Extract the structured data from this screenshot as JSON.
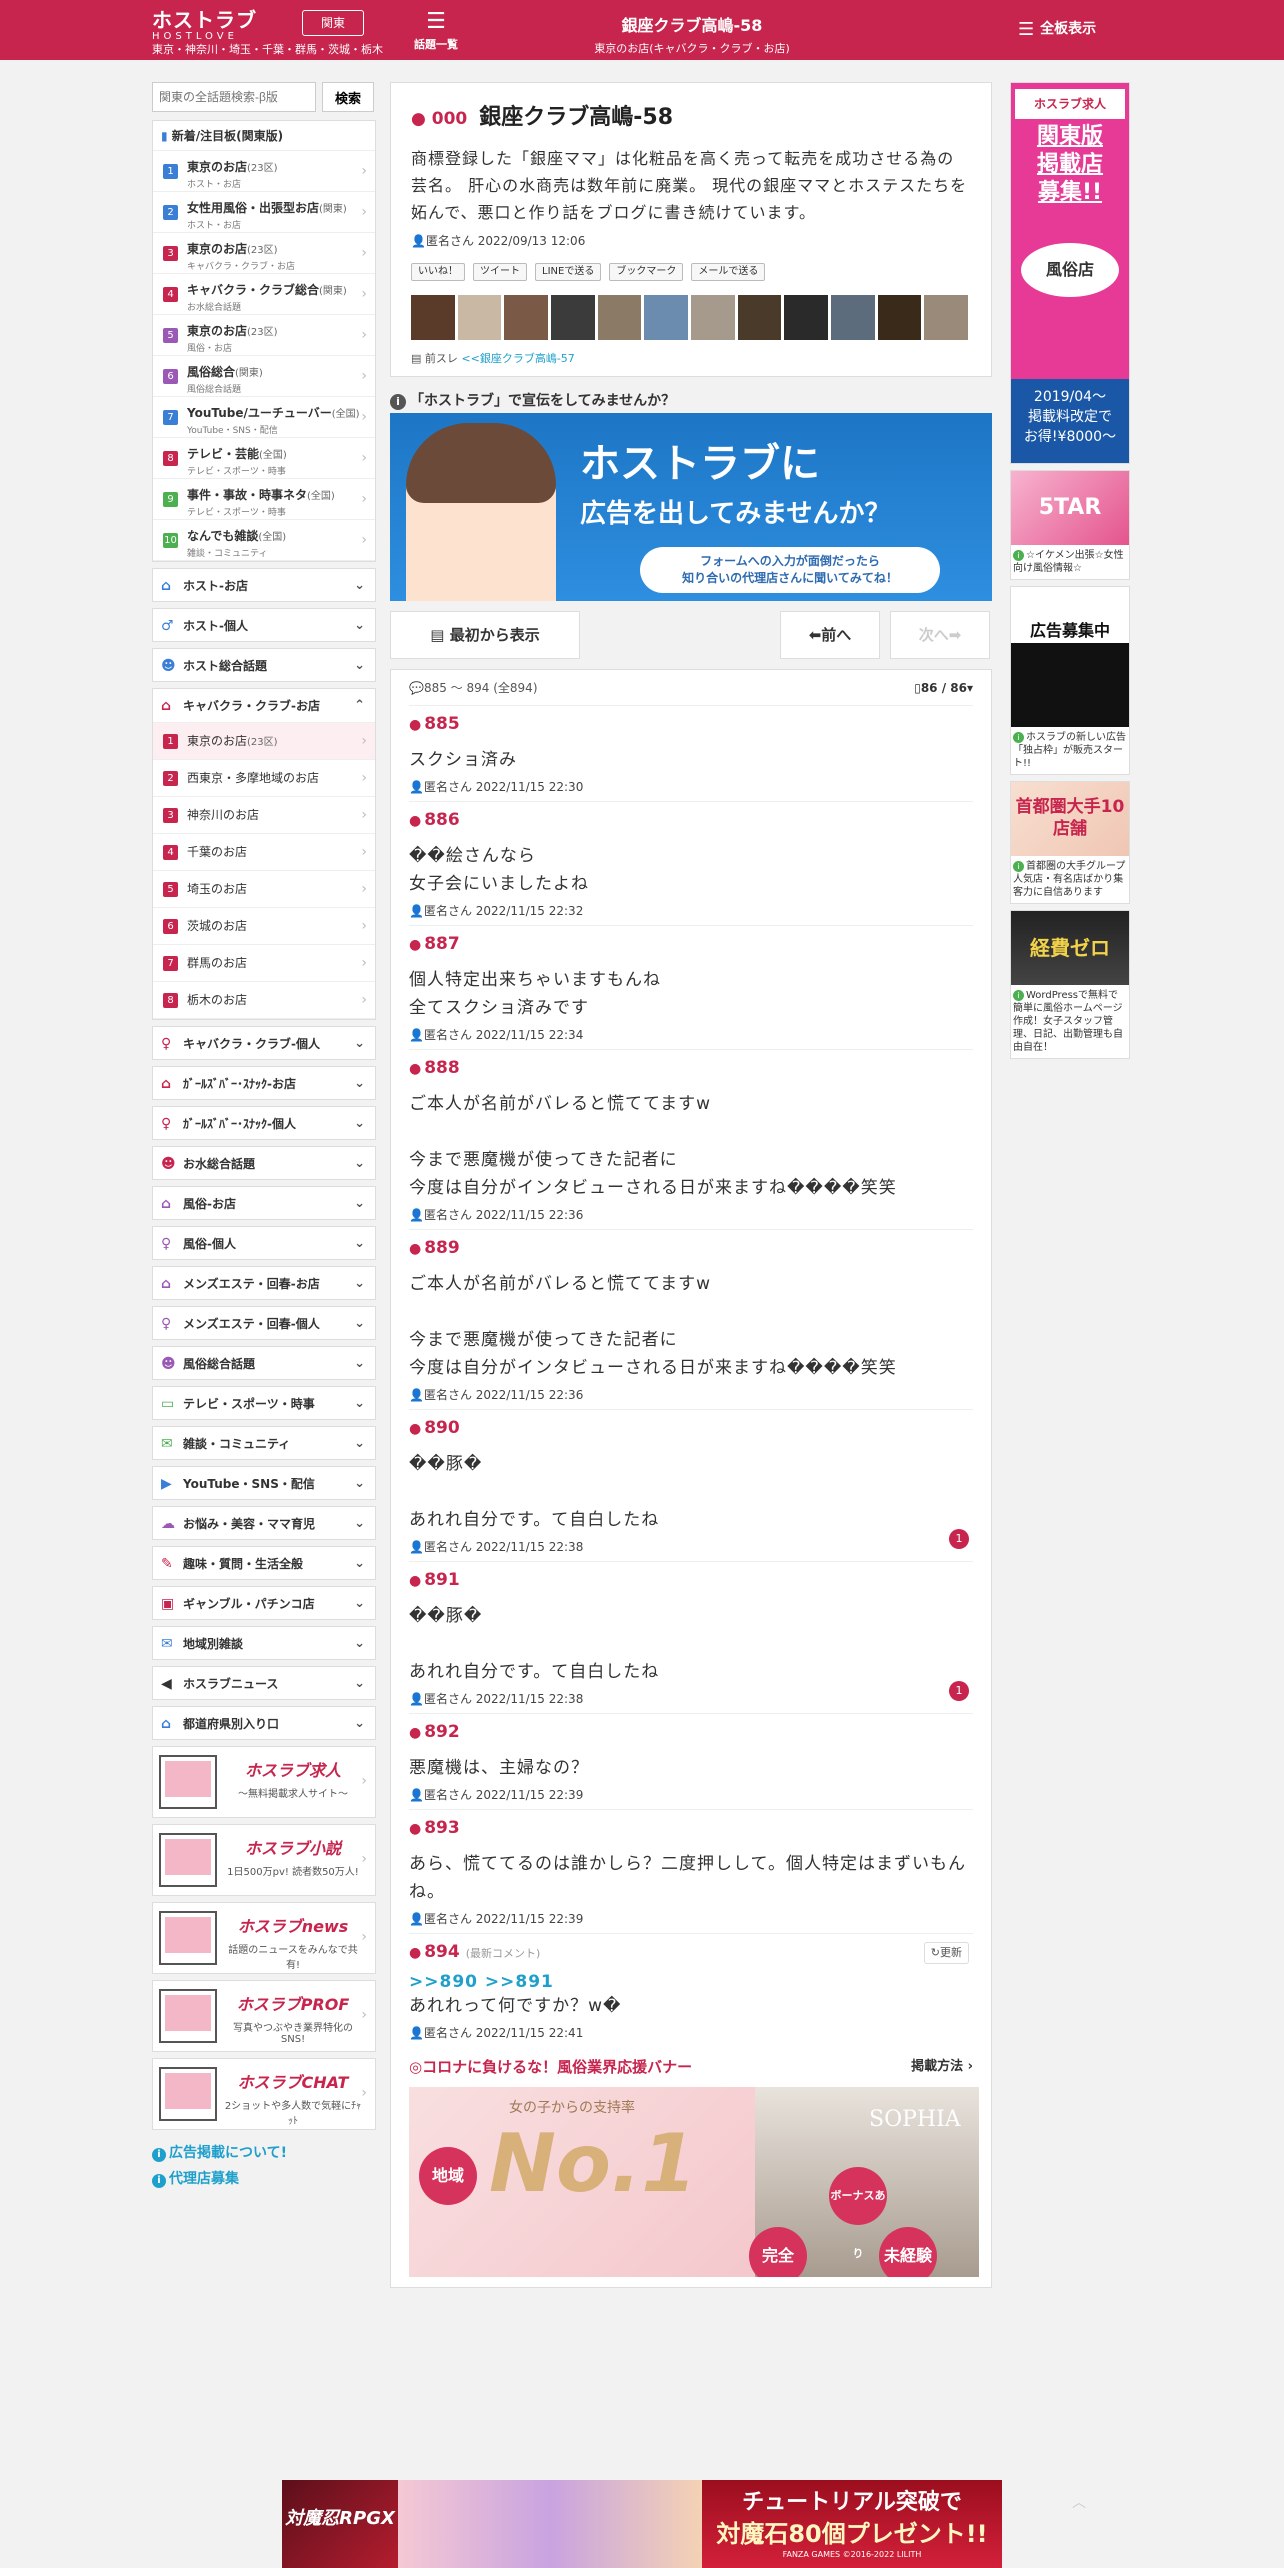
{
  "header": {
    "logo": "ホストラブ",
    "logo_sub": "HOSTLOVE",
    "region_button": "関東",
    "region_list": "東京・神奈川・埼玉・千葉・群馬・茨城・栃木",
    "topics_label": "話題一覧",
    "title": "銀座クラブ高嶋-58",
    "subtitle": "東京のお店(キャバクラ・クラブ・お店)",
    "all_boards": "全板表示"
  },
  "sidebar": {
    "search_placeholder": "関東の全話題検索-β版",
    "search_button": "検索",
    "new_heading": "新着/注目板(関東版)",
    "new_items": [
      {
        "num": "1",
        "title": "東京のお店",
        "extra": "(23区)",
        "sub": "ホスト・お店",
        "color": "#3a7fd5"
      },
      {
        "num": "2",
        "title": "女性用風俗・出張型お店",
        "extra": "(関東)",
        "sub": "ホスト・お店",
        "color": "#3a7fd5"
      },
      {
        "num": "3",
        "title": "東京のお店",
        "extra": "(23区)",
        "sub": "キャバクラ・クラブ・お店",
        "color": "#c7254e"
      },
      {
        "num": "4",
        "title": "キャバクラ・クラブ総合",
        "extra": "(関東)",
        "sub": "お水総合話題",
        "color": "#c7254e"
      },
      {
        "num": "5",
        "title": "東京のお店",
        "extra": "(23区)",
        "sub": "風俗・お店",
        "color": "#9b59b6"
      },
      {
        "num": "6",
        "title": "風俗総合",
        "extra": "(関東)",
        "sub": "風俗総合話題",
        "color": "#9b59b6"
      },
      {
        "num": "7",
        "title": "YouTube/ユーチューバー",
        "extra": "(全国)",
        "sub": "YouTube・SNS・配信",
        "color": "#3a7fd5"
      },
      {
        "num": "8",
        "title": "テレビ・芸能",
        "extra": "(全国)",
        "sub": "テレビ・スポーツ・時事",
        "color": "#c7254e"
      },
      {
        "num": "9",
        "title": "事件・事故・時事ネタ",
        "extra": "(全国)",
        "sub": "テレビ・スポーツ・時事",
        "color": "#4caf50"
      },
      {
        "num": "10",
        "title": "なんでも雑談",
        "extra": "(全国)",
        "sub": "雑談・コミュニティ",
        "color": "#4caf50"
      }
    ],
    "cats_a": [
      {
        "label": "ホスト-お店",
        "icon": "⌂",
        "color": "#3a7fd5"
      },
      {
        "label": "ホスト-個人",
        "icon": "♂",
        "color": "#3a7fd5"
      },
      {
        "label": "ホスト総合話題",
        "icon": "☻",
        "color": "#3a7fd5"
      }
    ],
    "open_cat": {
      "label": "キャバクラ・クラブ-お店",
      "icon": "⌂",
      "color": "#c7254e"
    },
    "open_items": [
      {
        "num": "1",
        "title": "東京のお店",
        "extra": "(23区)"
      },
      {
        "num": "2",
        "title": "西東京・多摩地域のお店",
        "extra": ""
      },
      {
        "num": "3",
        "title": "神奈川のお店",
        "extra": ""
      },
      {
        "num": "4",
        "title": "千葉のお店",
        "extra": ""
      },
      {
        "num": "5",
        "title": "埼玉のお店",
        "extra": ""
      },
      {
        "num": "6",
        "title": "茨城のお店",
        "extra": ""
      },
      {
        "num": "7",
        "title": "群馬のお店",
        "extra": ""
      },
      {
        "num": "8",
        "title": "栃木のお店",
        "extra": ""
      }
    ],
    "cats_b": [
      {
        "label": "キャバクラ・クラブ-個人",
        "icon": "♀",
        "color": "#c7254e"
      },
      {
        "label": "ｶﾞｰﾙｽﾞﾊﾞｰ･ｽﾅｯｸ-お店",
        "icon": "⌂",
        "color": "#c7254e"
      },
      {
        "label": "ｶﾞｰﾙｽﾞﾊﾞｰ･ｽﾅｯｸ-個人",
        "icon": "♀",
        "color": "#c7254e"
      },
      {
        "label": "お水総合話題",
        "icon": "☻",
        "color": "#c7254e"
      },
      {
        "label": "風俗-お店",
        "icon": "⌂",
        "color": "#9b59b6"
      },
      {
        "label": "風俗-個人",
        "icon": "♀",
        "color": "#9b59b6"
      },
      {
        "label": "メンズエステ・回春-お店",
        "icon": "⌂",
        "color": "#9b59b6"
      },
      {
        "label": "メンズエステ・回春-個人",
        "icon": "♀",
        "color": "#9b59b6"
      },
      {
        "label": "風俗総合話題",
        "icon": "☻",
        "color": "#9b59b6"
      },
      {
        "label": "テレビ・スポーツ・時事",
        "icon": "▭",
        "color": "#4caf50"
      },
      {
        "label": "雑談・コミュニティ",
        "icon": "✉",
        "color": "#4caf50"
      },
      {
        "label": "YouTube・SNS・配信",
        "icon": "▶",
        "color": "#3a7fd5"
      },
      {
        "label": "お悩み・美容・ママ育児",
        "icon": "☁",
        "color": "#9b59b6"
      },
      {
        "label": "趣味・質問・生活全般",
        "icon": "✎",
        "color": "#c7254e"
      },
      {
        "label": "ギャンブル・パチンコ店",
        "icon": "▣",
        "color": "#c7254e"
      },
      {
        "label": "地域別雑談",
        "icon": "✉",
        "color": "#3a7fd5"
      },
      {
        "label": "ホスラブニュース",
        "icon": "◀",
        "color": "#333"
      },
      {
        "label": "都道府県別入り口",
        "icon": "⌂",
        "color": "#3a7fd5"
      }
    ],
    "promos": [
      {
        "title": "ホスラブ求人",
        "sub": "〜無料掲載求人サイト〜"
      },
      {
        "title": "ホスラブ小説",
        "sub": "1日500万pv! 読者数50万人!"
      },
      {
        "title": "ホスラブnews",
        "sub": "話題のニュースをみんなで共有!"
      },
      {
        "title": "ホスラブPROF",
        "sub": "写真やつぶやき業界特化のSNS!"
      },
      {
        "title": "ホスラブCHAT",
        "sub": "2ショットや多人数で気軽にﾁｬｯﾄ"
      }
    ],
    "links": [
      "広告掲載について!",
      "代理店募集"
    ]
  },
  "thread": {
    "num": "000",
    "title": "銀座クラブ高嶋-58",
    "body": "商標登録した「銀座ママ」は化粧品を高く売って転売を成功させる為の芸名。 肝心の水商売は数年前に廃業。 現代の銀座ママとホステスたちを妬んで、悪口と作り話をブログに書き続けています。",
    "meta": "匿名さん 2022/09/13 12:06",
    "share": [
      "いいね！",
      "ツイート",
      "LINEで送る",
      "ブックマーク",
      "メールで送る"
    ],
    "prev_label": "前スレ",
    "prev_link": "<<銀座クラブ高嶋-57"
  },
  "ad_question": "「ホストラブ」で宣伝をしてみませんか？",
  "banner1": {
    "line1": "ホストラブに",
    "line2": "広告を出してみませんか？",
    "line3": "フォームへの入力が面倒だったら\n知り合いの代理店さんに聞いてみてね！"
  },
  "pager": {
    "first": "最初から表示",
    "prev": "前へ",
    "next": "次へ"
  },
  "posts_bar": {
    "range": "885 〜 894",
    "total": "(全894)",
    "page": "86 / 86"
  },
  "posts": [
    {
      "num": "885",
      "text": "スクショ済み",
      "meta": "匿名さん 2022/11/15 22:30",
      "badge": ""
    },
    {
      "num": "886",
      "text": "��絵さんなら\n女子会にいましたよね",
      "meta": "匿名さん 2022/11/15 22:32",
      "badge": ""
    },
    {
      "num": "887",
      "text": "個人特定出来ちゃいますもんね\n全てスクショ済みです",
      "meta": "匿名さん 2022/11/15 22:34",
      "badge": ""
    },
    {
      "num": "888",
      "text": "ご本人が名前がバレると慌ててますw\n\n今まで悪魔機が使ってきた記者に\n今度は自分がインタビューされる日が来ますね����笑笑",
      "meta": "匿名さん 2022/11/15 22:36",
      "badge": ""
    },
    {
      "num": "889",
      "text": "ご本人が名前がバレると慌ててますw\n\n今まで悪魔機が使ってきた記者に\n今度は自分がインタビューされる日が来ますね����笑笑",
      "meta": "匿名さん 2022/11/15 22:36",
      "badge": ""
    },
    {
      "num": "890",
      "text": "��豚�\n\nあれれ自分です。て自白したね",
      "meta": "匿名さん 2022/11/15 22:38",
      "badge": "1"
    },
    {
      "num": "891",
      "text": "��豚�\n\nあれれ自分です。て自白したね",
      "meta": "匿名さん 2022/11/15 22:38",
      "badge": "1"
    },
    {
      "num": "892",
      "text": "悪魔機は、主婦なの？",
      "meta": "匿名さん 2022/11/15 22:39",
      "badge": ""
    },
    {
      "num": "893",
      "text": "あら、慌ててるのは誰かしら？二度押しして。個人特定はまずいもんね。",
      "meta": "匿名さん 2022/11/15 22:39",
      "badge": ""
    }
  ],
  "last_post": {
    "num": "894",
    "newest": "(最新コメント)",
    "refresh": "更新",
    "reply": ">>890 >>891",
    "text": "あれれって何ですか？w�",
    "meta": "匿名さん 2022/11/15 22:41"
  },
  "corona": {
    "heading": "◎コロナに負けるな！風俗業界応援バナー",
    "how": "掲載方法",
    "sub": "女の子からの支持率",
    "big": "No.1",
    "brand": "SOPHIA",
    "c1": "地域",
    "c2": "ボーナスあり",
    "c3": "完全",
    "c4": "未経験"
  },
  "right_ads": {
    "a_top": "ホスラブ求人",
    "a_title": "関東版\n掲載店\n募集!!",
    "a_fz": "風俗店",
    "a_bottom": "2019/04〜\n掲載料改定で\nお得!¥8000〜",
    "caps": [
      "☆イケメン出張☆女性向け風俗情報☆",
      "ホスラブの新しい広告「独占枠」が販売スタート!!",
      "首都圏の大手グループ人気店・有名店ばかり集客力に自信あります",
      "WordPressで無料で簡単に風俗ホームページ作成！女子スタッフ管理、日記、出勤管理も自由自在！"
    ],
    "img2": "5TAR",
    "img3": "広告募集中",
    "img4": "首都圏大手10店舗",
    "img5": "経費ゼロ"
  },
  "bottom_banner": {
    "left": "対魔忍RPGX",
    "line1": "チュートリアル突破で",
    "line2": "対魔石80個プレゼント!!",
    "line3": "FANZA GAMES ©2016-2022 LILITH"
  }
}
